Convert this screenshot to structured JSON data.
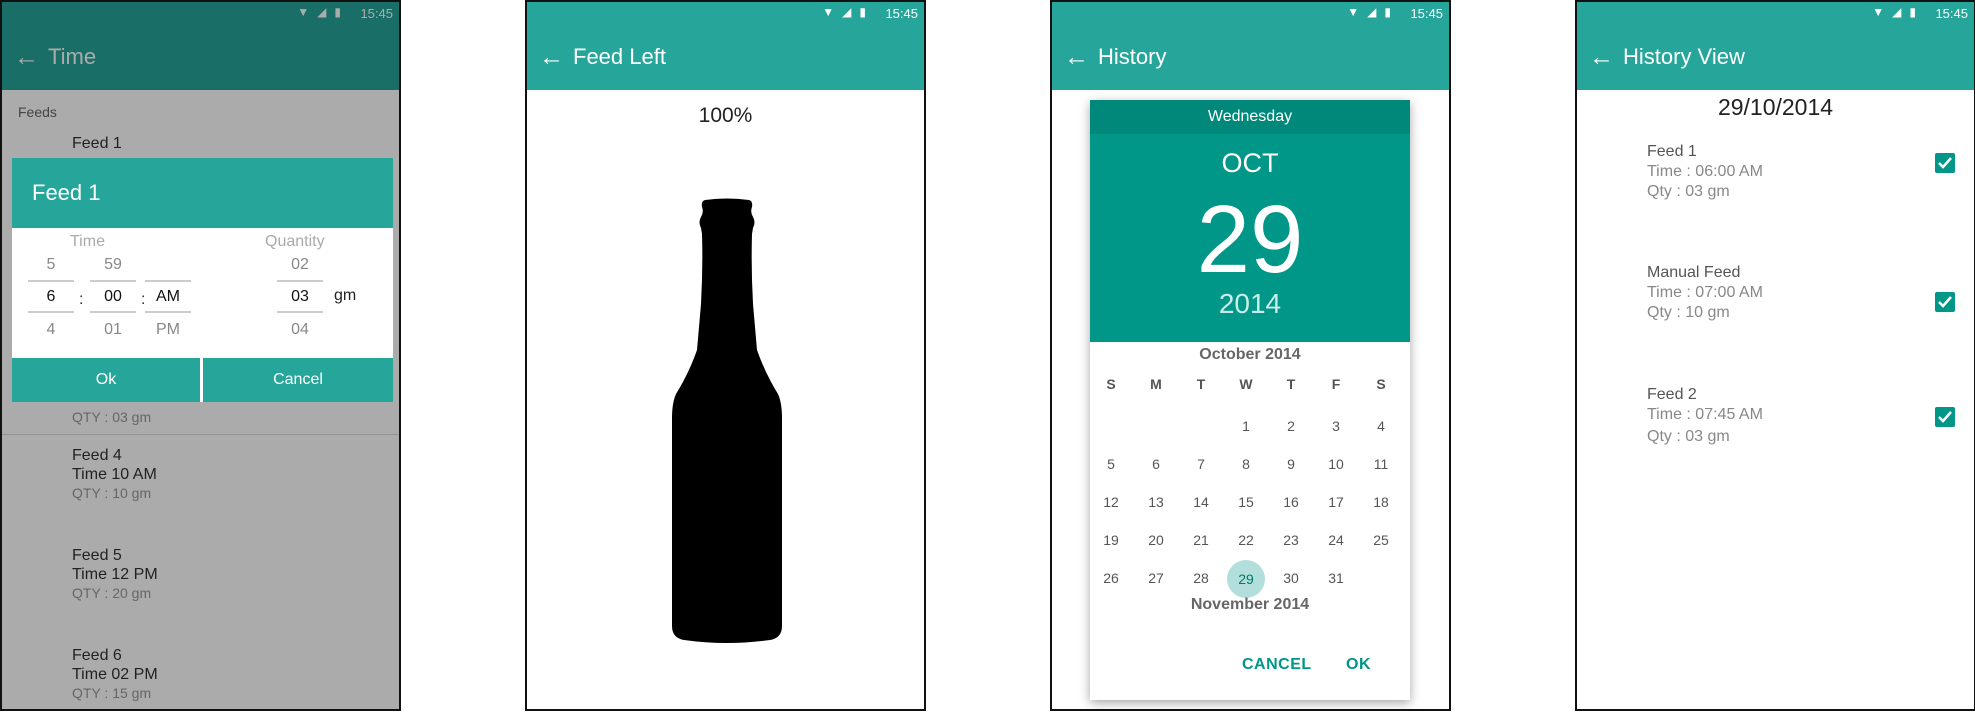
{
  "colors": {
    "primary": "#26a69a",
    "primary_dark": "#00897b",
    "accent": "#009688",
    "selected_day": "#b2dfdb"
  },
  "status_bar": {
    "time": "15:45",
    "icons": [
      "wifi-icon",
      "signal-icon",
      "battery-icon"
    ]
  },
  "time_screen": {
    "title": "Time",
    "section_label": "Feeds",
    "feeds": [
      {
        "name": "Feed 1",
        "time": "",
        "qty": ""
      },
      {
        "name": "Feed 4",
        "time": "Time 10 AM",
        "qty": "QTY : 10 gm"
      },
      {
        "name": "Feed 5",
        "time": "Time 12 PM",
        "qty": "QTY : 20 gm"
      },
      {
        "name": "Feed 6",
        "time": "Time 02 PM",
        "qty": "QTY : 15 gm"
      }
    ],
    "dialog": {
      "title": "Feed 1",
      "time_label": "Time",
      "quantity_label": "Quantity",
      "hour": {
        "prev": "5",
        "current": "6",
        "next": "4"
      },
      "minute": {
        "prev": "59",
        "current": "00",
        "next": "01"
      },
      "ampm": {
        "prev": "",
        "current": "AM",
        "next": "PM"
      },
      "quantity": {
        "prev": "02",
        "current": "03",
        "next": "04"
      },
      "unit": "gm",
      "separator": ":",
      "ok_label": "Ok",
      "cancel_label": "Cancel"
    }
  },
  "feed_left_screen": {
    "title": "Feed Left",
    "percentage": "100%",
    "fill_fraction": 1.0
  },
  "history_screen": {
    "title": "History",
    "picker": {
      "weekday": "Wednesday",
      "month": "OCT",
      "day": "29",
      "year": "2014",
      "month_title": "October 2014",
      "next_month_title": "November 2014",
      "weekdays": [
        "S",
        "M",
        "T",
        "W",
        "T",
        "F",
        "S"
      ],
      "first_weekday_index": 3,
      "days_in_month": 31,
      "selected_day": 29,
      "cancel_label": "CANCEL",
      "ok_label": "OK"
    }
  },
  "history_view_screen": {
    "title": "History View",
    "date": "29/10/2014",
    "entries": [
      {
        "name": "Feed 1",
        "time": "Time : 06:00 AM",
        "qty": "Qty : 03 gm",
        "checked": true
      },
      {
        "name": "Manual Feed",
        "time": "Time : 07:00 AM",
        "qty": "Qty : 10 gm",
        "checked": true
      },
      {
        "name": "Feed 2",
        "time": "Time : 07:45 AM",
        "qty": "Qty : 03 gm",
        "checked": true
      }
    ]
  }
}
